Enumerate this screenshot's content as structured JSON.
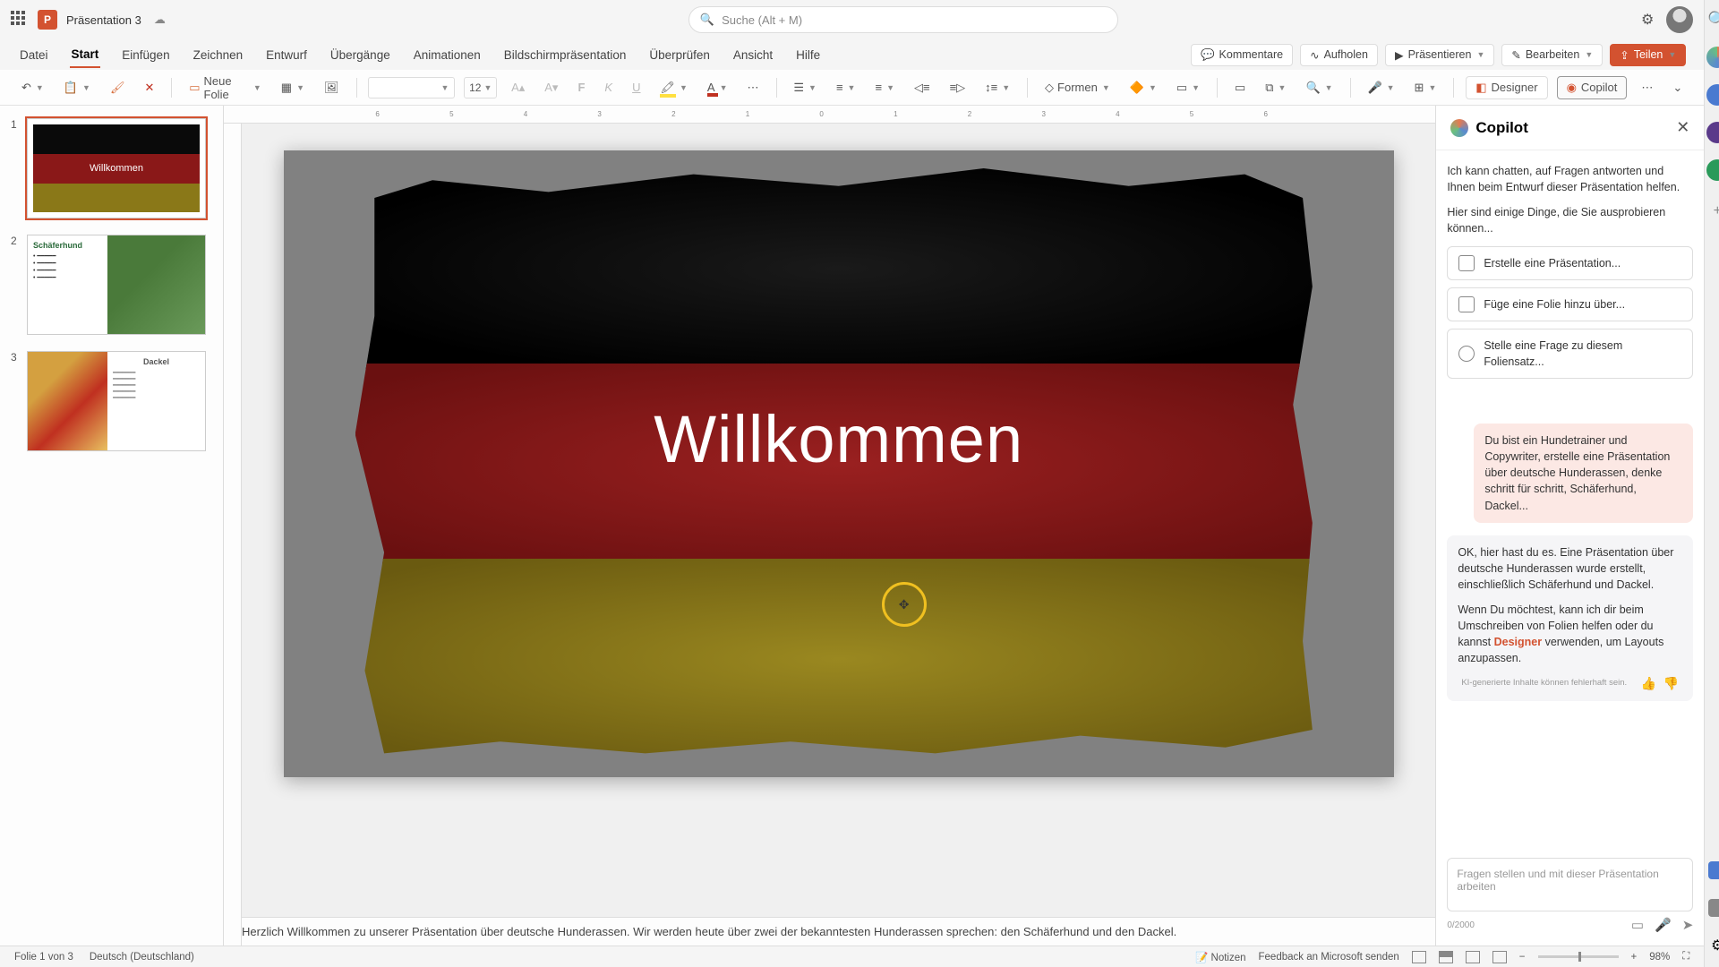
{
  "titlebar": {
    "app_letter": "P",
    "doc_title": "Präsentation 3",
    "search_placeholder": "Suche (Alt + M)"
  },
  "ribbon": {
    "tabs": [
      "Datei",
      "Start",
      "Einfügen",
      "Zeichnen",
      "Entwurf",
      "Übergänge",
      "Animationen",
      "Bildschirmpräsentation",
      "Überprüfen",
      "Ansicht",
      "Hilfe"
    ],
    "active_tab_index": 1,
    "comments": "Kommentare",
    "catchup": "Aufholen",
    "present": "Präsentieren",
    "edit": "Bearbeiten",
    "share": "Teilen"
  },
  "toolbar": {
    "new_slide": "Neue Folie",
    "font_size": "12",
    "shapes": "Formen",
    "designer": "Designer",
    "copilot": "Copilot"
  },
  "thumbnails": [
    {
      "num": "1",
      "title": "Willkommen"
    },
    {
      "num": "2",
      "title": "Schäferhund"
    },
    {
      "num": "3",
      "title": "Dackel"
    }
  ],
  "slide": {
    "title": "Willkommen"
  },
  "notes": "Herzlich Willkommen zu unserer Präsentation über deutsche Hunderassen. Wir werden heute über zwei der bekanntesten Hunderassen sprechen: den Schäferhund und den Dackel.",
  "copilot": {
    "title": "Copilot",
    "intro1": "Ich kann chatten, auf Fragen antworten und Ihnen beim Entwurf dieser Präsentation helfen.",
    "intro2": "Hier sind einige Dinge, die Sie ausprobieren können...",
    "suggest1": "Erstelle eine Präsentation...",
    "suggest2": "Füge eine Folie hinzu über...",
    "suggest3": "Stelle eine Frage zu diesem Foliensatz...",
    "user_msg": "Du bist ein Hundetrainer und Copywriter, erstelle eine Präsentation über deutsche Hunderassen, denke schritt für schritt, Schäferhund, Dackel...",
    "assist1": "OK, hier hast du es. Eine Präsentation über deutsche Hunderassen wurde erstellt, einschließlich Schäferhund und Dackel.",
    "assist2a": "Wenn Du möchtest, kann ich dir beim Umschreiben von Folien helfen oder du kannst ",
    "assist2_link": "Designer",
    "assist2b": " verwenden, um Layouts anzupassen.",
    "disclaimer": "KI-generierte Inhalte können fehlerhaft sein.",
    "input_placeholder": "Fragen stellen und mit dieser Präsentation arbeiten",
    "char_count": "0/2000"
  },
  "statusbar": {
    "slide_info": "Folie 1 von 3",
    "language": "Deutsch (Deutschland)",
    "notes_btn": "Notizen",
    "feedback": "Feedback an Microsoft senden",
    "zoom": "98%"
  },
  "ruler_marks": "6 5 4 3 2 1 0 1 2 3 4 5 6"
}
